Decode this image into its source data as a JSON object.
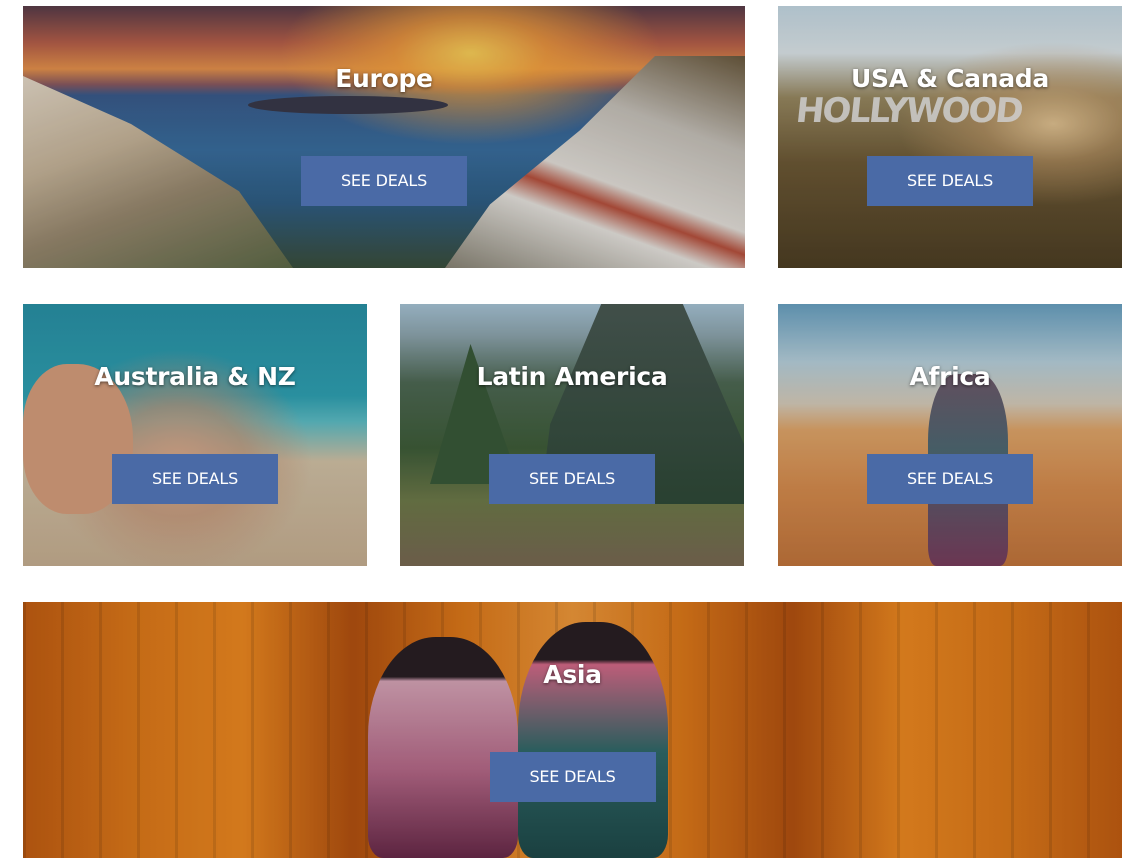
{
  "destinations": [
    {
      "name": "Europe",
      "button_label": "SEE DEALS"
    },
    {
      "name": "USA & Canada",
      "button_label": "SEE DEALS"
    },
    {
      "name": "Australia & NZ",
      "button_label": "SEE DEALS"
    },
    {
      "name": "Latin America",
      "button_label": "SEE DEALS"
    },
    {
      "name": "Africa",
      "button_label": "SEE DEALS"
    },
    {
      "name": "Asia",
      "button_label": "SEE DEALS"
    }
  ],
  "colors": {
    "button_background": "#4a6aa6",
    "title_text": "#ffffff",
    "button_text": "#ffffff"
  }
}
